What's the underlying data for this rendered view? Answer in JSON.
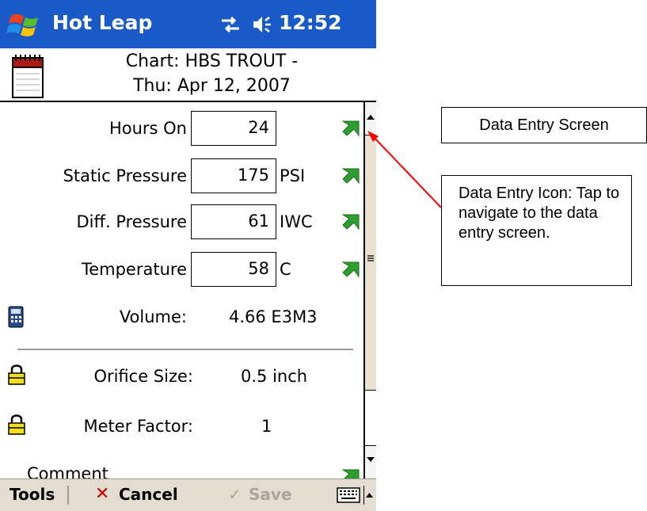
{
  "titlebar": {
    "app_title": "Hot Leap",
    "time": "12:52",
    "start_icon": "windows-flag-icon",
    "connectivity_icon": "connectivity-icon",
    "volume_icon": "speaker-icon",
    "color": "#1a5ac8"
  },
  "header": {
    "line1": "Chart: HBS TROUT -",
    "line2": "Thu: Apr 12, 2007",
    "icon": "notebook-icon"
  },
  "fields": [
    {
      "label": "Hours On",
      "value": "24",
      "unit": "",
      "icon": "green-arrow-icon"
    },
    {
      "label": "Static Pressure",
      "value": "175",
      "unit": "PSI",
      "icon": "green-arrow-icon"
    },
    {
      "label": "Diff. Pressure",
      "value": "61",
      "unit": "IWC",
      "icon": "green-arrow-icon"
    },
    {
      "label": "Temperature",
      "value": "58",
      "unit": "C",
      "icon": "green-arrow-icon"
    }
  ],
  "volume": {
    "label": "Volume:",
    "value": "4.66 E3M3",
    "icon": "calculator-icon"
  },
  "orifice": {
    "label": "Orifice Size:",
    "value": "0.5 inch",
    "icon": "padlock-icon"
  },
  "meter": {
    "label": "Meter Factor:",
    "value": "1",
    "icon": "padlock-icon"
  },
  "comment": {
    "label": "Comment"
  },
  "toolbar": {
    "tools": "Tools",
    "cancel_glyph": "✕",
    "cancel": "Cancel",
    "save_glyph": "✓",
    "save": "Save",
    "keyboard_icon": "keyboard-icon"
  },
  "annotations": {
    "box1": "Data Entry Screen",
    "box2": "Data Entry Icon: Tap to navigate to the data entry screen.",
    "arrow_color": "#ff0000"
  }
}
